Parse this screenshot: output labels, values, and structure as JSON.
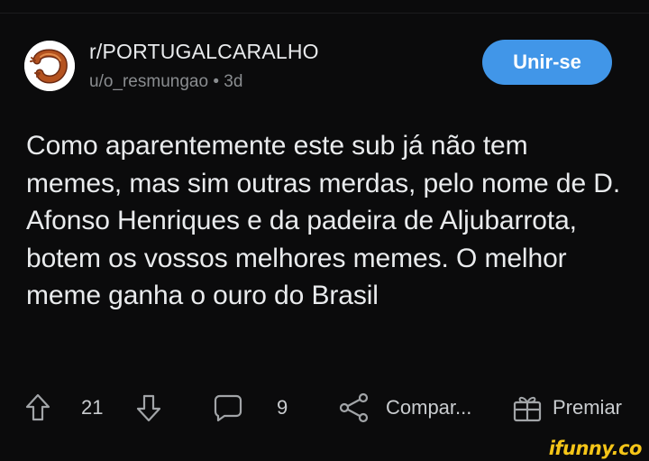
{
  "post": {
    "subreddit": "r/PORTUGALCARALHO",
    "author": "u/o_resmungao",
    "separator": "•",
    "age": "3d",
    "join_label": "Unir-se",
    "title": "Como aparentemente este sub já não tem memes, mas sim outras merdas, pelo nome de D. Afonso Henriques e da padeira de Aljubarrota, botem os vossos melhores memes. O melhor meme ganha o ouro do Brasil"
  },
  "actions": {
    "upvote_icon": "arrow-up-icon",
    "vote_count": "21",
    "downvote_icon": "arrow-down-icon",
    "comment_icon": "comment-bubble-icon",
    "comment_count": "9",
    "share_icon": "share-icon",
    "share_label": "Compar...",
    "award_icon": "gift-icon",
    "award_label": "Premiar"
  },
  "watermark": "ifunny.co",
  "colors": {
    "background": "#0b0b0c",
    "accent": "#4196e8",
    "watermark": "#f5c518"
  }
}
